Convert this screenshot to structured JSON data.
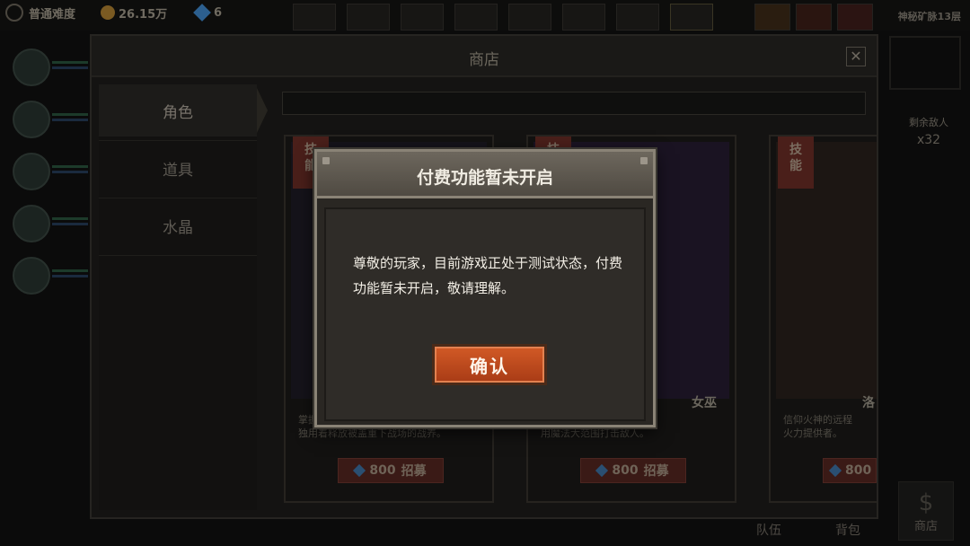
{
  "hud": {
    "difficulty": "普通难度",
    "gold": "26.15万",
    "gems": "6",
    "mine_floor": "神秘矿脉13层"
  },
  "side": {
    "enemies_label": "剩余敌人",
    "enemies_count": "x32"
  },
  "bottom_nav": {
    "team": "队伍",
    "bag": "背包",
    "shop": "商店"
  },
  "shop": {
    "title": "商店",
    "close": "✕",
    "tabs": [
      {
        "label": "角色",
        "active": true
      },
      {
        "label": "道具",
        "active": false
      },
      {
        "label": "水晶",
        "active": false
      }
    ],
    "cards": [
      {
        "skill_tag": "技能",
        "name": "",
        "desc": "掌握…\n独用着释放被盖重下战场的战养。",
        "price": "800",
        "action": "招募"
      },
      {
        "skill_tag": "技",
        "name": "女巫",
        "desc": "研究，擅长使\n用魔法大范围打击敌人。",
        "price": "800",
        "action": "招募"
      },
      {
        "skill_tag": "技能",
        "name": "洛",
        "desc": "信仰火神的远程\n火力提供者。",
        "price": "800",
        "action": ""
      }
    ]
  },
  "dialog": {
    "title": "付费功能暂未开启",
    "message": "尊敬的玩家，目前游戏正处于测试状态，付费功能暂未开启，敬请理解。",
    "confirm": "确认"
  }
}
